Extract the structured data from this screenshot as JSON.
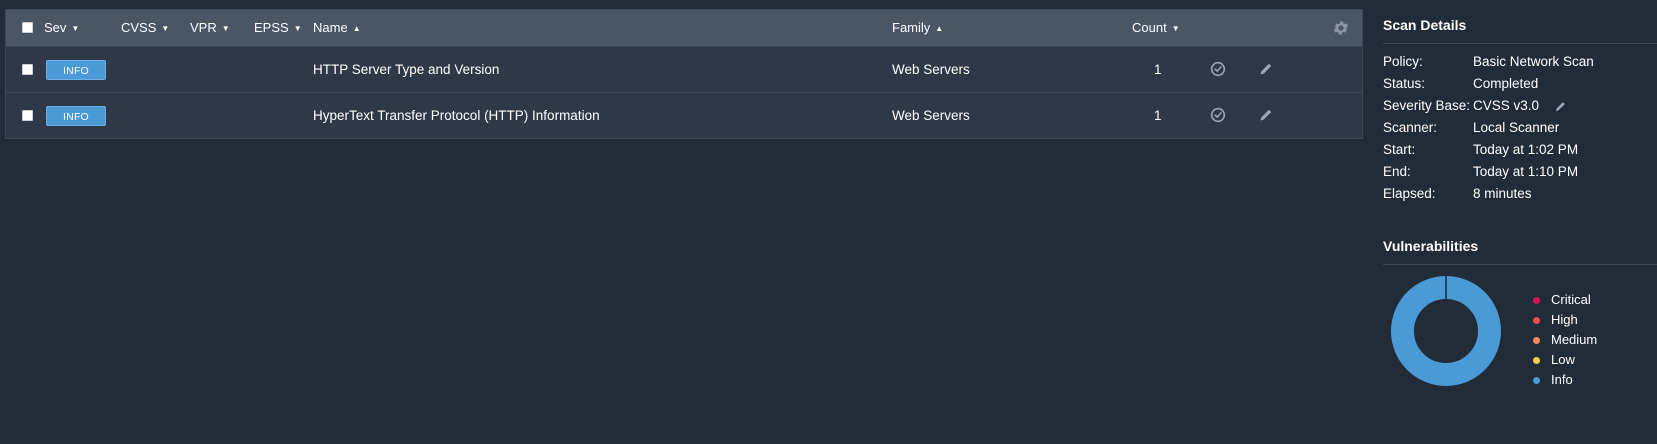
{
  "table": {
    "columns": {
      "sev": "Sev",
      "cvss": "CVSS",
      "vpr": "VPR",
      "epss": "EPSS",
      "name": "Name",
      "family": "Family",
      "count": "Count"
    },
    "rows": [
      {
        "severity": "INFO",
        "name": "HTTP Server Type and Version",
        "family": "Web Servers",
        "count": "1"
      },
      {
        "severity": "INFO",
        "name": "HyperText Transfer Protocol (HTTP) Information",
        "family": "Web Servers",
        "count": "1"
      }
    ]
  },
  "scan_details": {
    "title": "Scan Details",
    "fields": [
      {
        "label": "Policy:",
        "value": "Basic Network Scan"
      },
      {
        "label": "Status:",
        "value": "Completed"
      },
      {
        "label": "Severity Base:",
        "value": "CVSS v3.0"
      },
      {
        "label": "Scanner:",
        "value": "Local Scanner"
      },
      {
        "label": "Start:",
        "value": "Today at 1:02 PM"
      },
      {
        "label": "End:",
        "value": "Today at 1:10 PM"
      },
      {
        "label": "Elapsed:",
        "value": "8 minutes"
      }
    ]
  },
  "vulnerabilities": {
    "title": "Vulnerabilities",
    "legend": [
      {
        "label": "Critical",
        "color": "#d4145a"
      },
      {
        "label": "High",
        "color": "#ee4d4d"
      },
      {
        "label": "Medium",
        "color": "#f4895f"
      },
      {
        "label": "Low",
        "color": "#f5d04c"
      },
      {
        "label": "Info",
        "color": "#4b9ad8"
      }
    ]
  },
  "chart_data": {
    "type": "pie",
    "categories": [
      "Critical",
      "High",
      "Medium",
      "Low",
      "Info"
    ],
    "values": [
      0,
      0,
      0,
      0,
      2
    ]
  },
  "icons": {
    "settings": "gear-icon",
    "row_action_1": "clock-check-icon",
    "row_action_2": "pencil-icon",
    "severity_base_edit": "pencil-icon"
  }
}
